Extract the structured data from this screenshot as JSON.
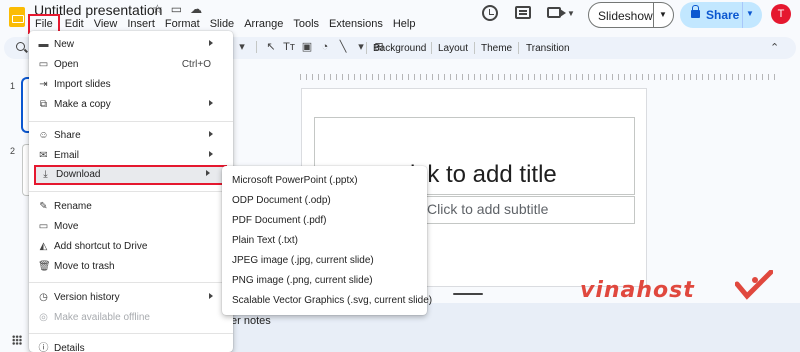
{
  "app": {
    "doc_title": "Untitled presentation",
    "menu": [
      "File",
      "Edit",
      "View",
      "Insert",
      "Format",
      "Slide",
      "Arrange",
      "Tools",
      "Extensions",
      "Help"
    ],
    "slideshow_label": "Slideshow",
    "share_label": "Share",
    "avatar_initial": "T",
    "highlight_color": "#e5182f"
  },
  "toolbar": {
    "background_label": "Background",
    "layout_label": "Layout",
    "theme_label": "Theme",
    "transition_label": "Transition"
  },
  "filmstrip": {
    "slide_numbers": [
      "1",
      "2"
    ]
  },
  "slide": {
    "title_placeholder": "ick to add title",
    "subtitle_placeholder": "Click to add subtitle"
  },
  "notes": {
    "placeholder": "er notes"
  },
  "file_menu": {
    "items": [
      {
        "label": "New",
        "icon": "new-file-icon",
        "submenu": true
      },
      {
        "label": "Open",
        "icon": "open-folder-icon",
        "shortcut": "Ctrl+O"
      },
      {
        "label": "Import slides",
        "icon": "import-icon"
      },
      {
        "label": "Make a copy",
        "icon": "copy-icon",
        "submenu": true
      },
      {
        "label": "Share",
        "icon": "person-add-icon",
        "submenu": true
      },
      {
        "label": "Email",
        "icon": "email-icon",
        "submenu": true
      },
      {
        "label": "Download",
        "icon": "download-icon",
        "submenu": true,
        "highlighted": true
      },
      {
        "label": "Rename",
        "icon": "pencil-icon"
      },
      {
        "label": "Move",
        "icon": "move-folder-icon"
      },
      {
        "label": "Add shortcut to Drive",
        "icon": "drive-shortcut-icon"
      },
      {
        "label": "Move to trash",
        "icon": "trash-icon"
      },
      {
        "label": "Version history",
        "icon": "history-icon",
        "submenu": true
      },
      {
        "label": "Make available offline",
        "icon": "offline-icon",
        "disabled": true
      },
      {
        "label": "Details",
        "icon": "info-icon"
      }
    ]
  },
  "download_menu": {
    "items": [
      "Microsoft PowerPoint (.pptx)",
      "ODP Document (.odp)",
      "PDF Document (.pdf)",
      "Plain Text (.txt)",
      "JPEG image (.jpg, current slide)",
      "PNG image (.png, current slide)",
      "Scalable Vector Graphics (.svg, current slide)"
    ]
  },
  "watermark": {
    "brand": "vinahost"
  }
}
